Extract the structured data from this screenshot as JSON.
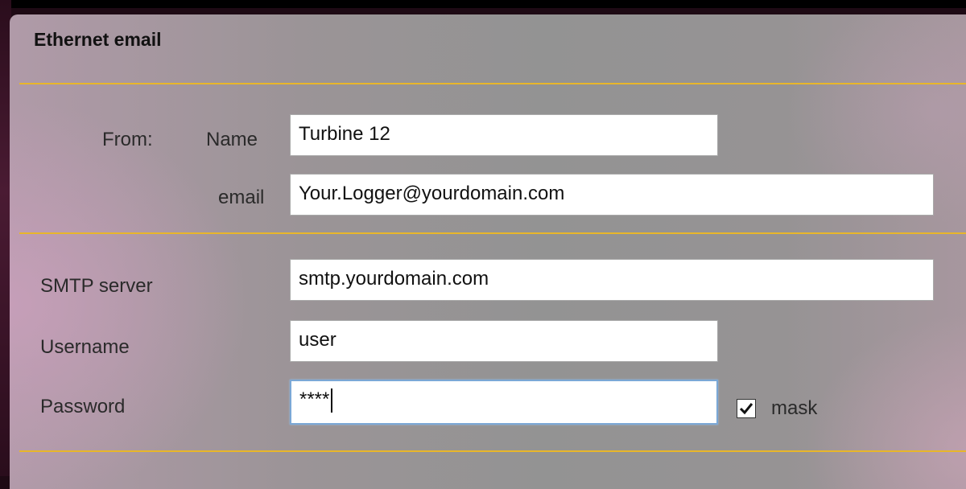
{
  "panel": {
    "title": "Ethernet email"
  },
  "from": {
    "label": "From:",
    "name_label": "Name",
    "name_value": "Turbine 12",
    "email_label": "email",
    "email_value": "Your.Logger@yourdomain.com"
  },
  "smtp": {
    "server_label": "SMTP server",
    "server_value": "smtp.yourdomain.com",
    "username_label": "Username",
    "username_value": "user",
    "password_label": "Password",
    "password_value": "****",
    "mask_label": "mask",
    "mask_checked": true
  },
  "colors": {
    "divider": "#e8b62a",
    "focus_border": "#7ba8d6"
  }
}
